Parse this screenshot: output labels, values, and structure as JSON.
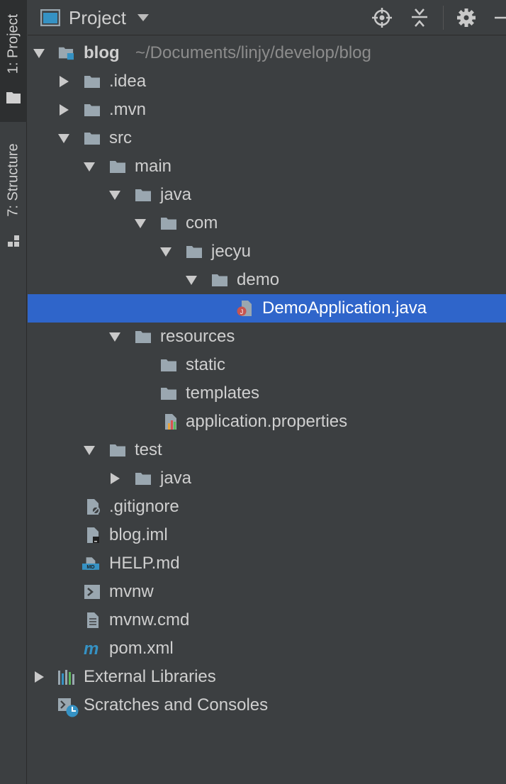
{
  "sidebar": {
    "project_tab": "1: Project",
    "structure_tab": "7: Structure"
  },
  "header": {
    "title": "Project",
    "icons": [
      "locate-icon",
      "collapse-all-icon",
      "settings-gear-icon",
      "hide-icon"
    ]
  },
  "colors": {
    "background": "#3c3f41",
    "selection": "#2f65ca",
    "folder": "#9aa7b0",
    "accent_blue": "#3592c4"
  },
  "tree": {
    "root": {
      "label": "blog",
      "path": "~/Documents/linjy/develop/blog"
    },
    "idea": ".idea",
    "mvn": ".mvn",
    "src": "src",
    "main": "main",
    "main_java": "java",
    "com": "com",
    "jecyu": "jecyu",
    "demo": "demo",
    "demo_app": "DemoApplication.java",
    "resources": "resources",
    "static": "static",
    "templates": "templates",
    "app_props": "application.properties",
    "test": "test",
    "test_java": "java",
    "gitignore": ".gitignore",
    "blog_iml": "blog.iml",
    "help_md": "HELP.md",
    "mvnw": "mvnw",
    "mvnw_cmd": "mvnw.cmd",
    "pom": "pom.xml",
    "external_libraries": "External Libraries",
    "scratches": "Scratches and Consoles"
  }
}
